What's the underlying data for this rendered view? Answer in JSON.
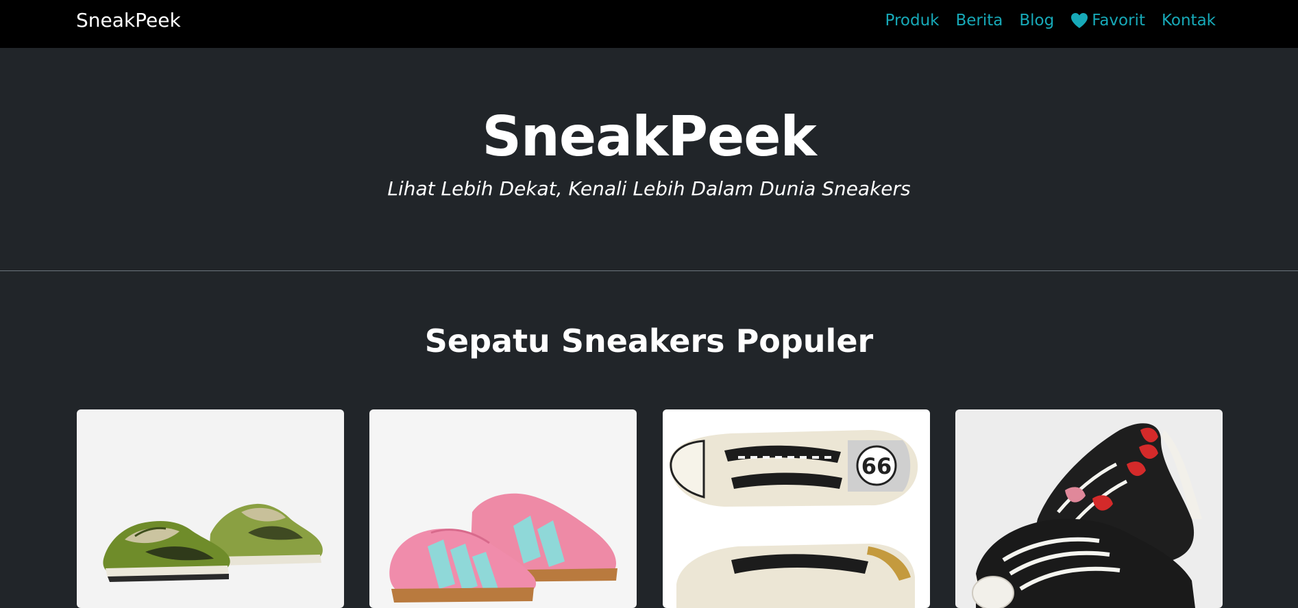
{
  "navbar": {
    "brand": "SneakPeek",
    "links": [
      {
        "label": "Produk"
      },
      {
        "label": "Berita"
      },
      {
        "label": "Blog"
      },
      {
        "label": "Favorit",
        "icon": "heart-icon"
      },
      {
        "label": "Kontak"
      }
    ],
    "link_color": "#17a9b8"
  },
  "hero": {
    "title": "SneakPeek",
    "subtitle": "Lihat Lebih Dekat, Kenali Lebih Dalam Dunia Sneakers"
  },
  "section": {
    "title": "Sepatu Sneakers Populer"
  },
  "products": [
    {
      "image": "green-dunk-low-sneakers"
    },
    {
      "image": "pink-adidas-hamburg-sneakers"
    },
    {
      "image": "onitsuka-tiger-mexico-66-cream-sneakers"
    },
    {
      "image": "cdg-play-converse-black-sneakers"
    }
  ],
  "colors": {
    "background": "#212529",
    "navbar": "#000000",
    "accent": "#17a9b8",
    "divider": "#6c757d"
  }
}
